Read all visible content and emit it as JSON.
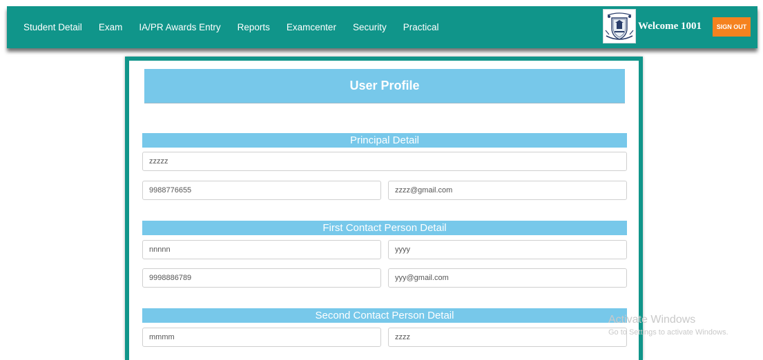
{
  "nav": {
    "items": [
      {
        "label": "Student Detail"
      },
      {
        "label": "Exam"
      },
      {
        "label": "IA/PR Awards Entry"
      },
      {
        "label": "Reports"
      },
      {
        "label": "Examcenter"
      },
      {
        "label": "Security"
      },
      {
        "label": "Practical"
      }
    ],
    "welcome": "Welcome 1001",
    "signout_label": "SIGN OUT"
  },
  "profile": {
    "title": "User Profile",
    "principal": {
      "heading": "Principal Detail",
      "name": "zzzzz",
      "phone": "9988776655",
      "email": "zzzz@gmail.com"
    },
    "first_contact": {
      "heading": "First Contact Person Detail",
      "name": "nnnnn",
      "designation": "yyyy",
      "phone": "9998886789",
      "email": "yyy@gmail.com"
    },
    "second_contact": {
      "heading": "Second Contact Person Detail",
      "name": "mmmm",
      "designation": "zzzz"
    }
  },
  "watermark": {
    "title": "Activate Windows",
    "subtitle": "Go to Settings to activate Windows."
  }
}
